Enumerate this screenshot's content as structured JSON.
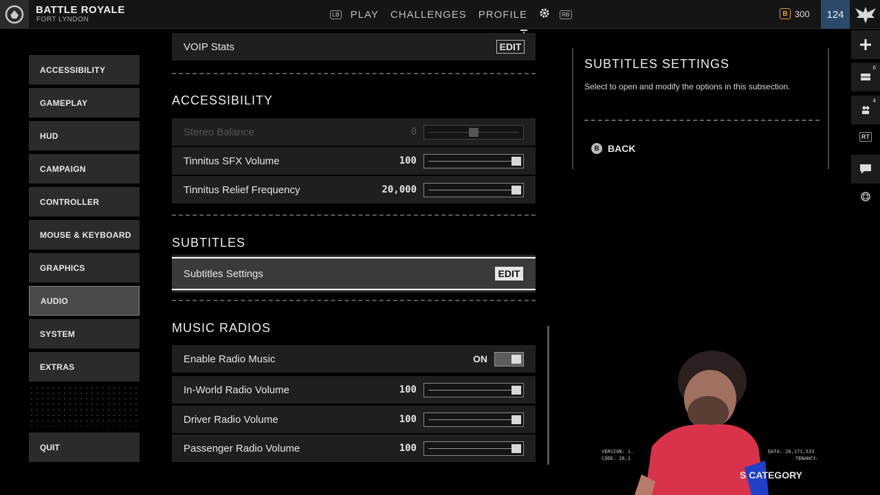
{
  "header": {
    "mode_title": "BATTLE ROYALE",
    "mode_subtitle": "FORT LYNDON",
    "lb_hint": "LB",
    "rb_hint": "RB",
    "tabs": [
      "PLAY",
      "CHALLENGES",
      "PROFILE"
    ],
    "currency_icon": "B",
    "currency_amount": "300",
    "player_level": "124"
  },
  "menu": {
    "items": [
      "ACCESSIBILITY",
      "GAMEPLAY",
      "HUD",
      "CAMPAIGN",
      "CONTROLLER",
      "MOUSE & KEYBOARD",
      "GRAPHICS",
      "AUDIO",
      "SYSTEM",
      "EXTRAS"
    ],
    "active": "AUDIO",
    "quit": "QUIT"
  },
  "settings": {
    "voip_stats": {
      "label": "VOIP Stats",
      "button": "EDIT"
    },
    "accessibility_header": "ACCESSIBILITY",
    "stereo_balance": {
      "label": "Stereo Balance",
      "value": "0",
      "level": 0.5
    },
    "tinnitus_sfx": {
      "label": "Tinnitus SFX Volume",
      "value": "100",
      "level": 1.0
    },
    "tinnitus_relief": {
      "label": "Tinnitus Relief Frequency",
      "value": "20,000",
      "level": 1.0
    },
    "subtitles_header": "SUBTITLES",
    "subtitles_settings": {
      "label": "Subtitles Settings",
      "button": "EDIT"
    },
    "music_header": "MUSIC RADIOS",
    "enable_radio": {
      "label": "Enable Radio Music",
      "value": "ON"
    },
    "in_world_radio": {
      "label": "In-World Radio Volume",
      "value": "100",
      "level": 1.0
    },
    "driver_radio": {
      "label": "Driver Radio Volume",
      "value": "100",
      "level": 1.0
    },
    "passenger_radio": {
      "label": "Passenger Radio Volume",
      "value": "100",
      "level": 1.0
    }
  },
  "panel": {
    "title": "SUBTITLES SETTINGS",
    "description": "Select to open and modify the options in this subsection.",
    "back_icon": "B",
    "back_label": "BACK"
  },
  "rail": {
    "mail_badge": "6",
    "social_badge": "4",
    "rt_label": "RT"
  },
  "footer": {
    "version": "VERSION: 1.",
    "code": "CODE: 26,1",
    "data": "DATA: 26,171,533",
    "tenancy": "TENANCY:",
    "category": "S   CATEGORY"
  },
  "icons": {
    "mode": "helmet-icon",
    "settings": "gear-icon",
    "rank": "eagle-icon",
    "add": "plus-icon",
    "mail": "mail-icon",
    "social": "friends-icon",
    "chat": "chat-icon",
    "window": "window-icon"
  },
  "colors": {
    "currency": "#e0a030",
    "level_bg": "#2c4a6a",
    "focus": "#ffffff"
  }
}
